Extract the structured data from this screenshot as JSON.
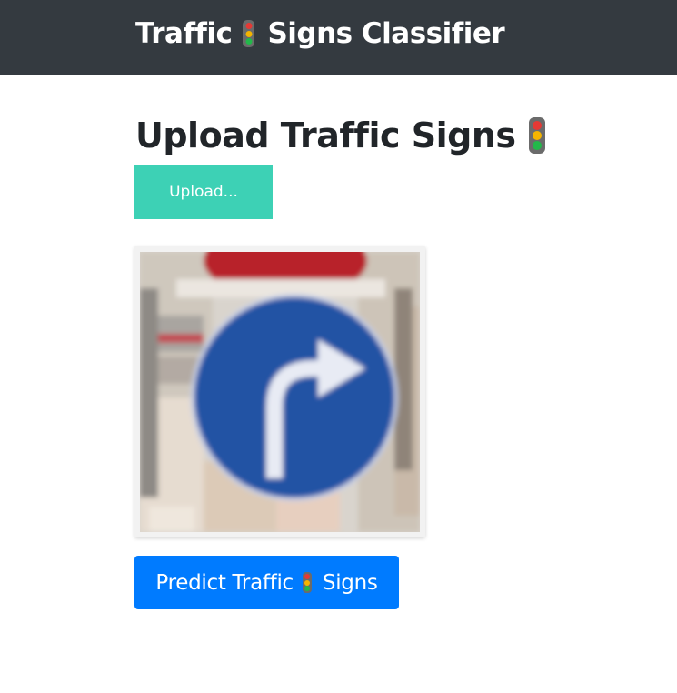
{
  "navbar": {
    "brand_part1": "Traffic",
    "brand_icon": "traffic-light-icon",
    "brand_part2": "Signs Classifier",
    "background": "#343a40"
  },
  "main": {
    "heading": "Upload Traffic Signs",
    "heading_icon": "traffic-light-icon",
    "upload_label": "Upload...",
    "upload_color": "#3dd1b5",
    "preview_icon": "turn-right-sign-image",
    "predict_part1": "Predict Traffic",
    "predict_icon": "traffic-light-icon",
    "predict_part2": "Signs",
    "predict_color": "#007bff"
  }
}
